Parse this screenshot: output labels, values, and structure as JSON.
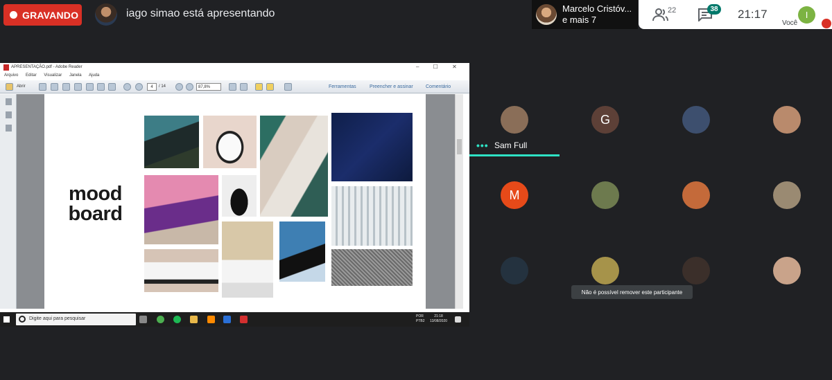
{
  "recording": {
    "label": "GRAVANDO"
  },
  "presenter": {
    "text": "iago simao está apresentando"
  },
  "people": {
    "line1": "Marcelo Cristóv...",
    "line2": "e mais 7"
  },
  "controls": {
    "participants_count": "22",
    "chat_count": "38",
    "time": "21:17",
    "self_initial": "I",
    "self_label": "Você"
  },
  "reader": {
    "title": "APRESENTAÇÃO.pdf - Adobe Reader",
    "window_controls": "–  ☐  ✕",
    "menu": [
      "Arquivo",
      "Editar",
      "Visualizar",
      "Janela",
      "Ajuda"
    ],
    "open_label": "Abrir",
    "page_current": "4",
    "page_total": "/ 14",
    "zoom": "87,8%",
    "tools": "Ferramentas",
    "fill_sign": "Preencher e assinar",
    "comment": "Comentário"
  },
  "document": {
    "title_line1": "mood",
    "title_line2": "board"
  },
  "taskbar": {
    "search_placeholder": "Digite aqui para pesquisar",
    "lang": "POR\nPTB2",
    "clock_time": "21:18",
    "clock_date": "13/08/2020"
  },
  "grid": {
    "speaker_name": "Sam Full",
    "tooltip": "Não é possível remover este participante",
    "tiles": [
      {
        "initial": "",
        "color": "#8a6e58"
      },
      {
        "initial": "G",
        "color": "#5d4037"
      },
      {
        "initial": "",
        "color": "#3d4f6e"
      },
      {
        "initial": "",
        "color": "#b98a6c"
      },
      {
        "initial": "M",
        "color": "#e64a19"
      },
      {
        "initial": "",
        "color": "#6d7a4e"
      },
      {
        "initial": "",
        "color": "#c46a3a"
      },
      {
        "initial": "",
        "color": "#9a8a72"
      },
      {
        "initial": "",
        "color": "#24323f"
      },
      {
        "initial": "",
        "color": "#a6934a"
      },
      {
        "initial": "",
        "color": "#3b2f2a"
      },
      {
        "initial": "",
        "color": "#c9a38a"
      }
    ]
  }
}
